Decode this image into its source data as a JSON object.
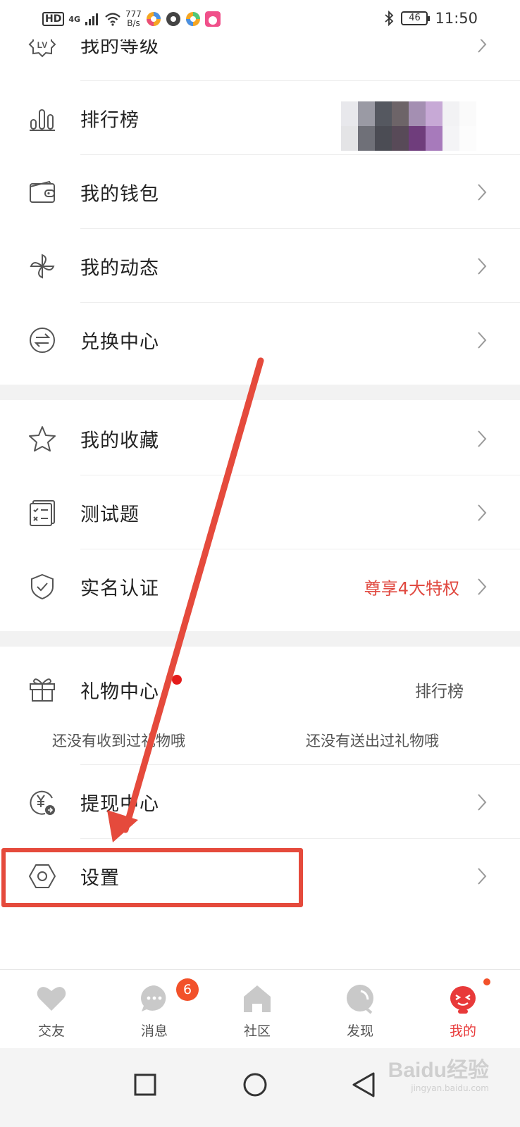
{
  "status_bar": {
    "hd": "HD",
    "network": "4G",
    "speed_value": "777",
    "speed_unit": "B/s",
    "battery": "46",
    "time": "11:50"
  },
  "menu_group1": [
    {
      "label": "我的等级",
      "icon": "level-icon"
    },
    {
      "label": "排行榜",
      "icon": "rank-bars-icon"
    },
    {
      "label": "我的钱包",
      "icon": "wallet-icon"
    },
    {
      "label": "我的动态",
      "icon": "pinwheel-icon"
    },
    {
      "label": "兑换中心",
      "icon": "exchange-icon"
    }
  ],
  "menu_group2": [
    {
      "label": "我的收藏",
      "icon": "star-icon"
    },
    {
      "label": "测试题",
      "icon": "quiz-icon"
    },
    {
      "label": "实名认证",
      "icon": "shield-check-icon",
      "right_text": "尊享4大特权"
    }
  ],
  "gift": {
    "label": "礼物中心",
    "rank_link": "排行榜",
    "received_text": "还没有收到过礼物哦",
    "sent_text": "还没有送出过礼物哦"
  },
  "menu_group3": [
    {
      "label": "提现中心",
      "icon": "withdraw-icon"
    },
    {
      "label": "设置",
      "icon": "settings-hexagon-icon"
    }
  ],
  "tabbar": {
    "items": [
      {
        "label": "交友",
        "icon": "heart-icon"
      },
      {
        "label": "消息",
        "icon": "chat-bubble-icon",
        "badge": "6"
      },
      {
        "label": "社区",
        "icon": "home-icon"
      },
      {
        "label": "发现",
        "icon": "discover-icon"
      },
      {
        "label": "我的",
        "icon": "mascot-icon",
        "active": true
      }
    ]
  },
  "watermark": {
    "line1": "Baidu经验",
    "line2": "jingyan.baidu.com"
  },
  "colors": {
    "accent": "#e83a3a",
    "annotation": "#e54a3c",
    "privilege": "#e0483f"
  }
}
